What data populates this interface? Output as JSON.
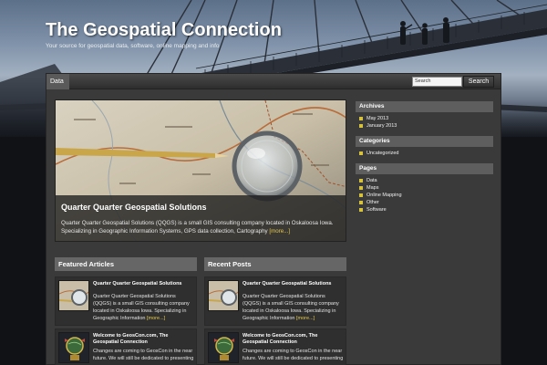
{
  "site": {
    "title": "The Geospatial Connection",
    "tagline": "Your source for geospatial data, software, online mapping and info"
  },
  "nav": {
    "items": [
      "Data"
    ],
    "search_placeholder": "Search",
    "search_button": "Search"
  },
  "featured_slide": {
    "title": "Quarter Quarter Geospatial Solutions",
    "excerpt": "Quarter Quarter Geospatial Solutions (QQGS) is a small GIS consulting company located in Oskaloosa Iowa. Specializing in Geographic Information Systems, GPS data collection, Cartography",
    "more": "[more...]"
  },
  "sidebar": {
    "archives": {
      "title": "Archives",
      "items": [
        "May 2013",
        "January 2013"
      ]
    },
    "categories": {
      "title": "Categories",
      "items": [
        "Uncategorized"
      ]
    },
    "pages": {
      "title": "Pages",
      "items": [
        "Data",
        "Maps",
        "Online Mapping",
        "Other",
        "Software"
      ]
    }
  },
  "featured_articles": {
    "title": "Featured Articles",
    "posts": [
      {
        "title": "Quarter Quarter Geospatial Solutions",
        "excerpt": "Quarter Quarter Geospatial Solutions (QQGS) is a small GIS consulting company located in Oskaloosa Iowa. Specializing in Geographic Information",
        "more": "[more...]"
      },
      {
        "title": "Welcome to GeosCon.com, The Geospatial Connection",
        "excerpt": "Changes are coming to GeosCon in the near future. We will still be dedicated to presenting",
        "more": ""
      }
    ]
  },
  "recent_posts": {
    "title": "Recent Posts",
    "posts": [
      {
        "title": "Quarter Quarter Geospatial Solutions",
        "excerpt": "Quarter Quarter Geospatial Solutions (QQGS) is a small GIS consulting company located in Oskaloosa Iowa. Specializing in Geographic Information",
        "more": "[more...]"
      },
      {
        "title": "Welcome to GeosCon.com, The Geospatial Connection",
        "excerpt": "Changes are coming to GeosCon in the near future. We will still be dedicated to presenting",
        "more": ""
      }
    ]
  },
  "colors": {
    "accent_bullet": "#d6c23c",
    "more_link": "#e6c94a",
    "panel_bg": "#3a3a3a",
    "widget_header": "#5e5e5e"
  }
}
